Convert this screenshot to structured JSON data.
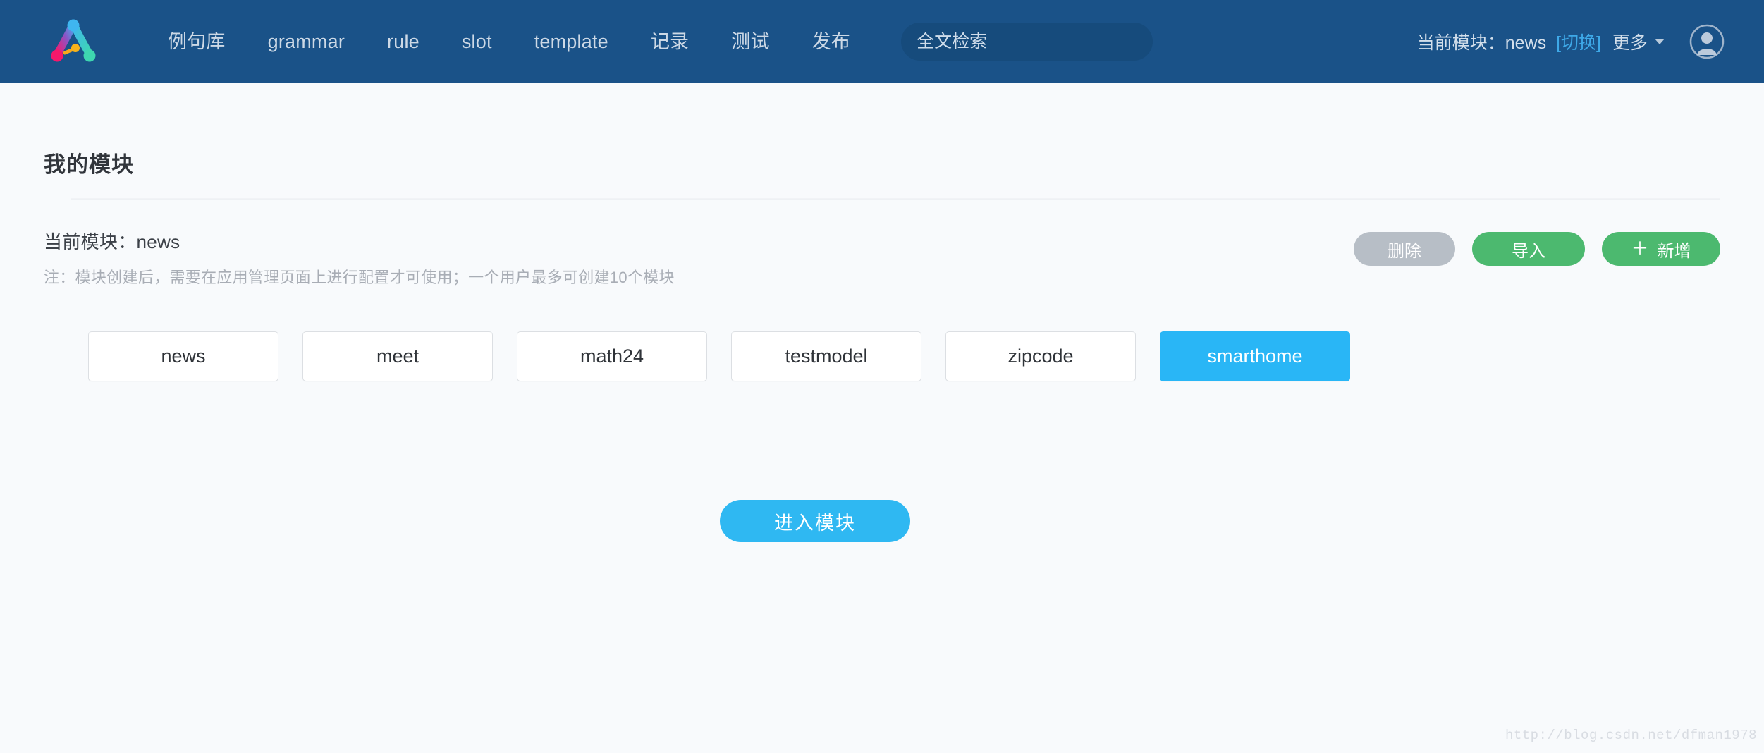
{
  "header": {
    "logo_name": "app-logo",
    "nav_items": [
      {
        "label": "例句库"
      },
      {
        "label": "grammar"
      },
      {
        "label": "rule"
      },
      {
        "label": "slot"
      },
      {
        "label": "template"
      },
      {
        "label": "记录"
      },
      {
        "label": "测试"
      },
      {
        "label": "发布"
      }
    ],
    "search": {
      "placeholder": "全文检索",
      "value": "",
      "icon": "search-icon"
    },
    "current_module_label": "当前模块：news",
    "switch_link": "[切换]",
    "more_label": "更多",
    "avatar_icon": "user-avatar-icon"
  },
  "page": {
    "title": "我的模块",
    "current_module": "当前模块：news",
    "note": "注：模块创建后，需要在应用管理页面上进行配置才可使用；一个用户最多可创建10个模块"
  },
  "actions": {
    "delete_label": "删除",
    "import_label": "导入",
    "add_plus": "＋",
    "add_label": "新增"
  },
  "modules": [
    {
      "name": "news",
      "selected": false
    },
    {
      "name": "meet",
      "selected": false
    },
    {
      "name": "math24",
      "selected": false
    },
    {
      "name": "testmodel",
      "selected": false
    },
    {
      "name": "zipcode",
      "selected": false
    },
    {
      "name": "smarthome",
      "selected": true
    }
  ],
  "enter_button": {
    "label": "进入模块"
  },
  "watermark": {
    "text": "http://blog.csdn.net/dfman1978"
  },
  "colors": {
    "navbar_bg": "#1a5288",
    "search_bg": "#164b7c",
    "page_bg": "#f8fafc",
    "accent_blue": "#29b6f6",
    "accent_green": "#4cb96f",
    "disabled_gray": "#b7bec6",
    "link_blue": "#3ea9e8"
  }
}
